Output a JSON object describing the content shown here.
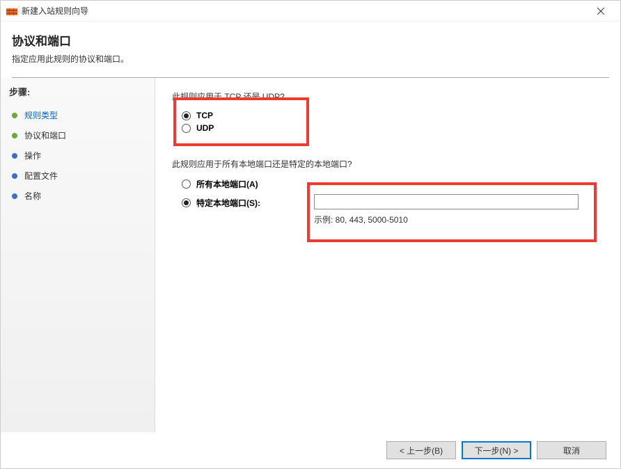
{
  "titlebar": {
    "title": "新建入站规则向导"
  },
  "header": {
    "title": "协议和端口",
    "subtitle": "指定应用此规则的协议和端口。"
  },
  "sidebar": {
    "title": "步骤:",
    "items": [
      {
        "label": "规则类型"
      },
      {
        "label": "协议和端口"
      },
      {
        "label": "操作"
      },
      {
        "label": "配置文件"
      },
      {
        "label": "名称"
      }
    ]
  },
  "content": {
    "question1": "此规则应用于 TCP 还是 UDP?",
    "protocol": {
      "tcp": "TCP",
      "udp": "UDP"
    },
    "question2": "此规则应用于所有本地端口还是特定的本地端口?",
    "ports": {
      "all": "所有本地端口(A)",
      "specific": "特定本地端口(S):"
    },
    "port_input_value": "",
    "port_example": "示例: 80, 443, 5000-5010"
  },
  "footer": {
    "back": "< 上一步(B)",
    "next": "下一步(N) >",
    "cancel": "取消"
  }
}
